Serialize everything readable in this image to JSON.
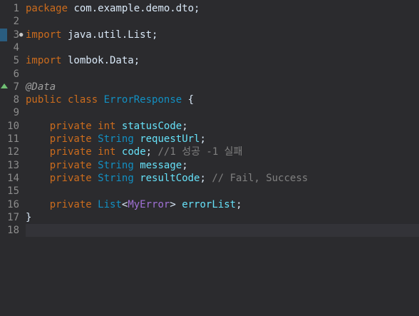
{
  "editor": {
    "lines": [
      {
        "n": "1",
        "tokens": [
          {
            "t": "package",
            "c": "kw"
          },
          {
            "t": " com.example.demo.dto;",
            "c": "plain"
          }
        ]
      },
      {
        "n": "2",
        "tokens": []
      },
      {
        "n": "3",
        "tokens": [
          {
            "t": "import",
            "c": "kw"
          },
          {
            "t": " java.util.List;",
            "c": "plain"
          }
        ]
      },
      {
        "n": "4",
        "tokens": []
      },
      {
        "n": "5",
        "tokens": [
          {
            "t": "import",
            "c": "kw"
          },
          {
            "t": " lombok.Data;",
            "c": "plain"
          }
        ]
      },
      {
        "n": "6",
        "tokens": []
      },
      {
        "n": "7",
        "tokens": [
          {
            "t": "@Data",
            "c": "ann"
          }
        ]
      },
      {
        "n": "8",
        "tokens": [
          {
            "t": "public",
            "c": "kw"
          },
          {
            "t": " ",
            "c": "plain"
          },
          {
            "t": "class",
            "c": "kw"
          },
          {
            "t": " ",
            "c": "plain"
          },
          {
            "t": "ErrorResponse",
            "c": "type"
          },
          {
            "t": " {",
            "c": "plain"
          }
        ]
      },
      {
        "n": "9",
        "tokens": []
      },
      {
        "n": "10",
        "tokens": [
          {
            "t": "    ",
            "c": "plain"
          },
          {
            "t": "private",
            "c": "kw"
          },
          {
            "t": " ",
            "c": "plain"
          },
          {
            "t": "int",
            "c": "kw"
          },
          {
            "t": " ",
            "c": "plain"
          },
          {
            "t": "statusCode",
            "c": "field"
          },
          {
            "t": ";",
            "c": "plain"
          }
        ]
      },
      {
        "n": "11",
        "tokens": [
          {
            "t": "    ",
            "c": "plain"
          },
          {
            "t": "private",
            "c": "kw"
          },
          {
            "t": " ",
            "c": "plain"
          },
          {
            "t": "String",
            "c": "type"
          },
          {
            "t": " ",
            "c": "plain"
          },
          {
            "t": "requestUrl",
            "c": "field"
          },
          {
            "t": ";",
            "c": "plain"
          }
        ]
      },
      {
        "n": "12",
        "tokens": [
          {
            "t": "    ",
            "c": "plain"
          },
          {
            "t": "private",
            "c": "kw"
          },
          {
            "t": " ",
            "c": "plain"
          },
          {
            "t": "int",
            "c": "kw"
          },
          {
            "t": " ",
            "c": "plain"
          },
          {
            "t": "code",
            "c": "field"
          },
          {
            "t": "; ",
            "c": "plain"
          },
          {
            "t": "//1 성공 -1 실패",
            "c": "comment"
          }
        ]
      },
      {
        "n": "13",
        "tokens": [
          {
            "t": "    ",
            "c": "plain"
          },
          {
            "t": "private",
            "c": "kw"
          },
          {
            "t": " ",
            "c": "plain"
          },
          {
            "t": "String",
            "c": "type"
          },
          {
            "t": " ",
            "c": "plain"
          },
          {
            "t": "message",
            "c": "field"
          },
          {
            "t": ";",
            "c": "plain"
          }
        ]
      },
      {
        "n": "14",
        "tokens": [
          {
            "t": "    ",
            "c": "plain"
          },
          {
            "t": "private",
            "c": "kw"
          },
          {
            "t": " ",
            "c": "plain"
          },
          {
            "t": "String",
            "c": "type"
          },
          {
            "t": " ",
            "c": "plain"
          },
          {
            "t": "resultCode",
            "c": "field"
          },
          {
            "t": "; ",
            "c": "plain"
          },
          {
            "t": "// Fail, Success",
            "c": "comment"
          }
        ]
      },
      {
        "n": "15",
        "tokens": []
      },
      {
        "n": "16",
        "tokens": [
          {
            "t": "    ",
            "c": "plain"
          },
          {
            "t": "private",
            "c": "kw"
          },
          {
            "t": " ",
            "c": "plain"
          },
          {
            "t": "List",
            "c": "type"
          },
          {
            "t": "<",
            "c": "plain"
          },
          {
            "t": "MyError",
            "c": "generic-purple"
          },
          {
            "t": "> ",
            "c": "plain"
          },
          {
            "t": "errorList",
            "c": "field"
          },
          {
            "t": ";",
            "c": "plain"
          }
        ]
      },
      {
        "n": "17",
        "tokens": [
          {
            "t": "}",
            "c": "plain"
          }
        ]
      },
      {
        "n": "18",
        "tokens": []
      }
    ],
    "current_line": "18",
    "bookmark_line": "3",
    "fold_line": "3",
    "annotation_marker_line": "7",
    "colors": {
      "background": "#2b2b2e",
      "keyword": "#cc6c1d",
      "type": "#1290c3",
      "field": "#66e1f8",
      "comment": "#808080",
      "annotation": "#a0a0a0",
      "line_number": "#8d8d8d",
      "current_line_bg": "#333338"
    }
  }
}
